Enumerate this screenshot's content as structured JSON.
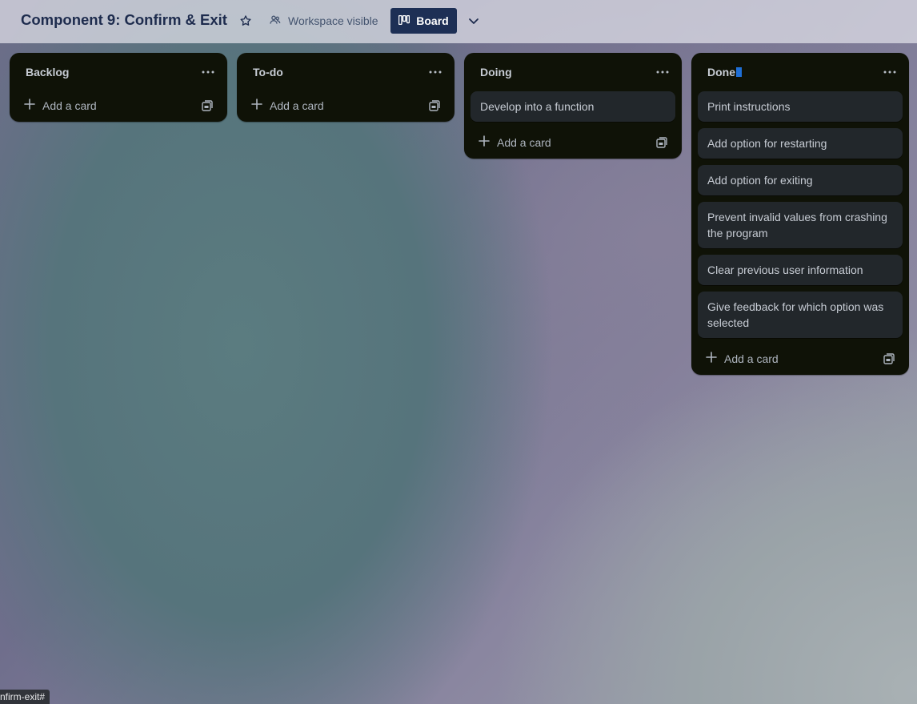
{
  "header": {
    "board_title": "Component 9: Confirm & Exit",
    "visibility_label": "Workspace visible",
    "view_label": "Board"
  },
  "lists": [
    {
      "title": "Backlog",
      "cards": [],
      "add_label": "Add a card"
    },
    {
      "title": "To-do",
      "cards": [],
      "add_label": "Add a card"
    },
    {
      "title": "Doing",
      "cards": [
        "Develop into a function"
      ],
      "add_label": "Add a card"
    },
    {
      "title": "Done",
      "cards": [
        "Print instructions",
        "Add option for restarting",
        "Add option for exiting",
        "Prevent invalid values from crashing the program",
        "Clear previous user information",
        "Give feedback for which option was selected"
      ],
      "add_label": "Add a card"
    }
  ],
  "status_bar": {
    "url_text": "nfirm-exit#"
  },
  "colors": {
    "header_title": "#1d2b4d",
    "view_button_bg": "#1d2f55",
    "list_bg": "#0f1207",
    "card_bg": "#22272b",
    "text": "#c7ccd4"
  },
  "icons": {
    "star": "star-icon",
    "visibility": "workspace-visibility-icon",
    "board": "board-view-icon",
    "chevron": "chevron-down-icon",
    "list_menu": "more-horizontal-icon",
    "add": "plus-icon",
    "template": "card-template-icon"
  }
}
